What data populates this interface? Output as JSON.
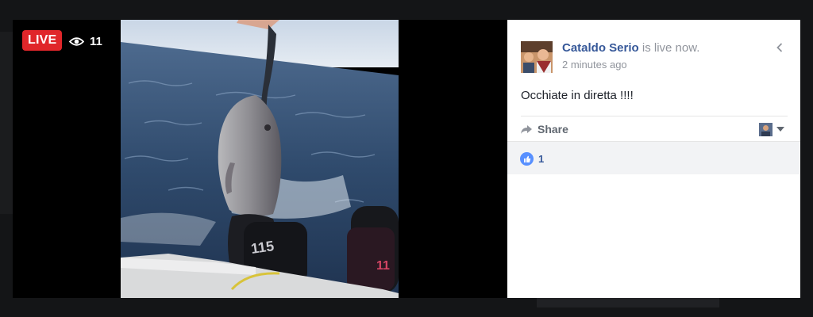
{
  "stream": {
    "live_label": "LIVE",
    "viewer_count": "11",
    "icons": {
      "eye": "eye-icon"
    }
  },
  "post": {
    "author": "Cataldo Serio",
    "status": " is live now.",
    "time": "2 minutes ago",
    "message": "Occhiate in diretta !!!!",
    "share_label": "Share",
    "like_count": "1"
  },
  "colors": {
    "live_red": "#e0262a",
    "link_blue": "#365899",
    "like_blue": "#5890ff"
  }
}
